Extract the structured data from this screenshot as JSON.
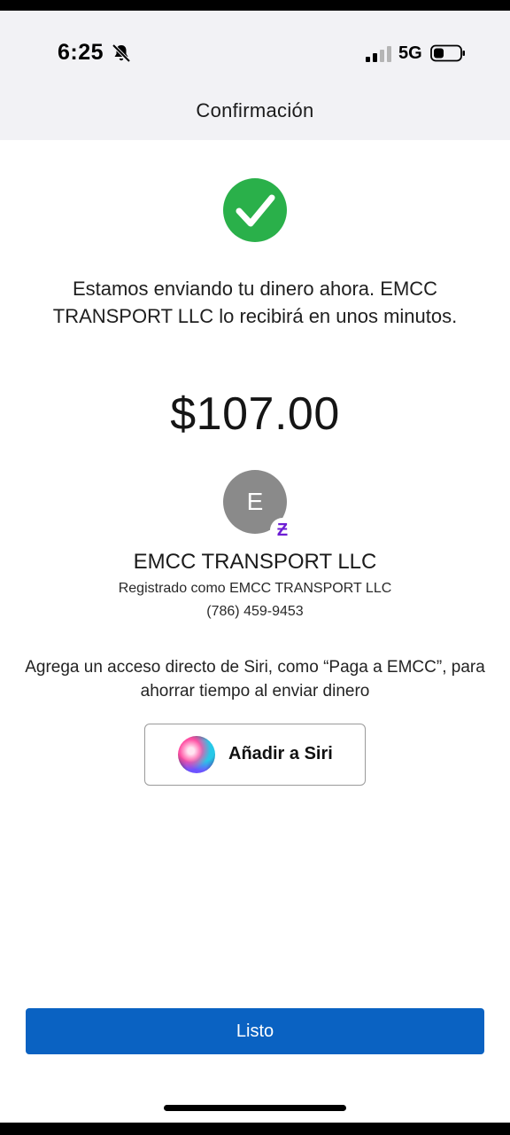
{
  "status_bar": {
    "time": "6:25",
    "network": "5G",
    "icons": [
      "bell-slash-icon",
      "signal-icon",
      "battery-icon"
    ]
  },
  "header": {
    "title": "Confirmación"
  },
  "confirmation": {
    "icon": "checkmark-circle-icon",
    "icon_color": "#2ab04a",
    "message": "Estamos enviando tu dinero ahora. EMCC TRANSPORT LLC lo recibirá en unos minutos.",
    "amount": "$107.00"
  },
  "recipient": {
    "initial": "E",
    "badge": "Ƶ",
    "badge_color": "#6d1ed4",
    "name": "EMCC TRANSPORT LLC",
    "registered_as": "Registrado como EMCC TRANSPORT LLC",
    "phone": "(786) 459-9453"
  },
  "siri": {
    "prompt": "Agrega un acceso directo de Siri, como “Paga a EMCC”, para ahorrar tiempo al enviar dinero",
    "button_label": "Añadir a Siri",
    "icon": "siri-orb-icon"
  },
  "footer": {
    "done_label": "Listo",
    "accent": "#0a62c2"
  }
}
